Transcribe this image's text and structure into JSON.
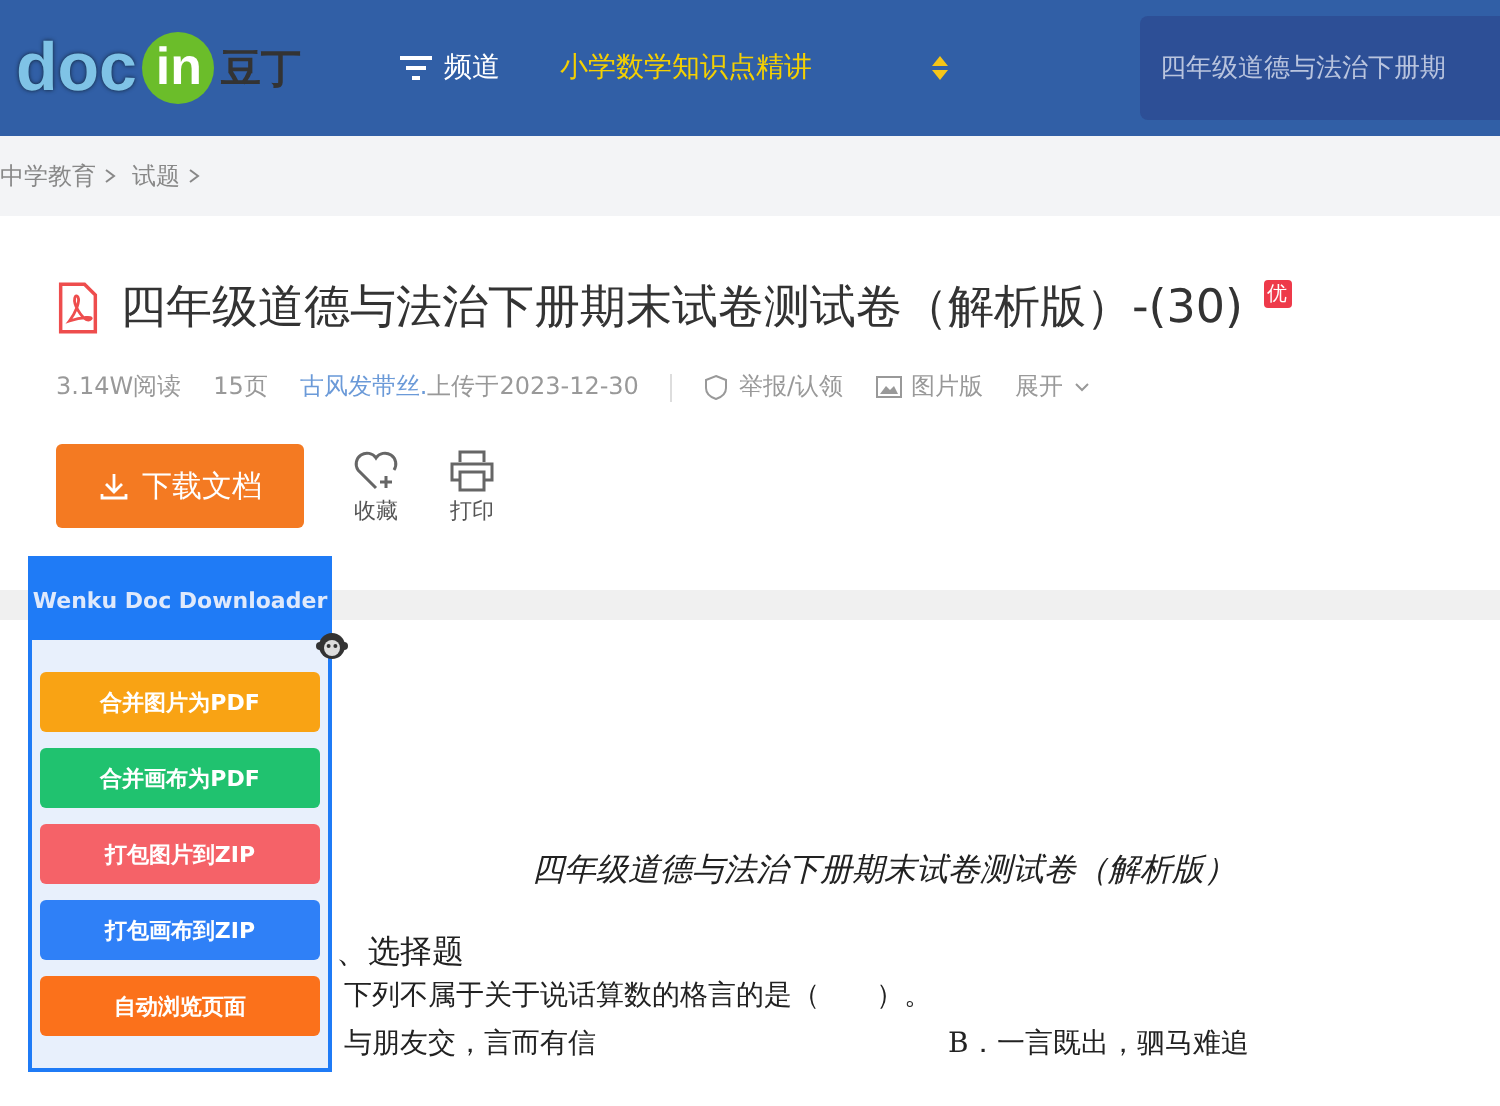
{
  "header": {
    "logo": {
      "part_1": "doc",
      "part_2": "in",
      "part_3": "豆丁"
    },
    "channel": "频道",
    "topic": "小学数学知识点精讲",
    "search": {
      "value": "四年级道德与法治下册期"
    }
  },
  "breadcrumb": [
    "中学教育",
    "试题"
  ],
  "document": {
    "title": "四年级道德与法治下册期末试卷测试卷（解析版）-(30)",
    "badge": "优",
    "reads": "3.14W阅读",
    "pages": "15页",
    "uploader": "古风发带丝.",
    "uploaded": "上传于2023-12-30",
    "report": "举报/认领",
    "image_version": "图片版",
    "expand": "展开"
  },
  "actions": {
    "download": "下载文档",
    "favorite": "收藏",
    "print": "打印"
  },
  "plugin": {
    "title": "Wenku Doc Downloader",
    "buttons": [
      {
        "label": "合并图片为PDF",
        "color": "#f9a314"
      },
      {
        "label": "合并画布为PDF",
        "color": "#20c26f"
      },
      {
        "label": "打包图片到ZIP",
        "color": "#f56268"
      },
      {
        "label": "打包画布到ZIP",
        "color": "#2f80f7"
      },
      {
        "label": "自动浏览页面",
        "color": "#fb711b"
      }
    ]
  },
  "page": {
    "heading": "四年级道德与法治下册期末试卷测试卷（解析版）",
    "section": "、选择题",
    "question": "下列不属于关于说话算数的格言的是（　　）。",
    "options": [
      "与朋友交，言而有信",
      "B．一言既出，驷马难追"
    ]
  }
}
